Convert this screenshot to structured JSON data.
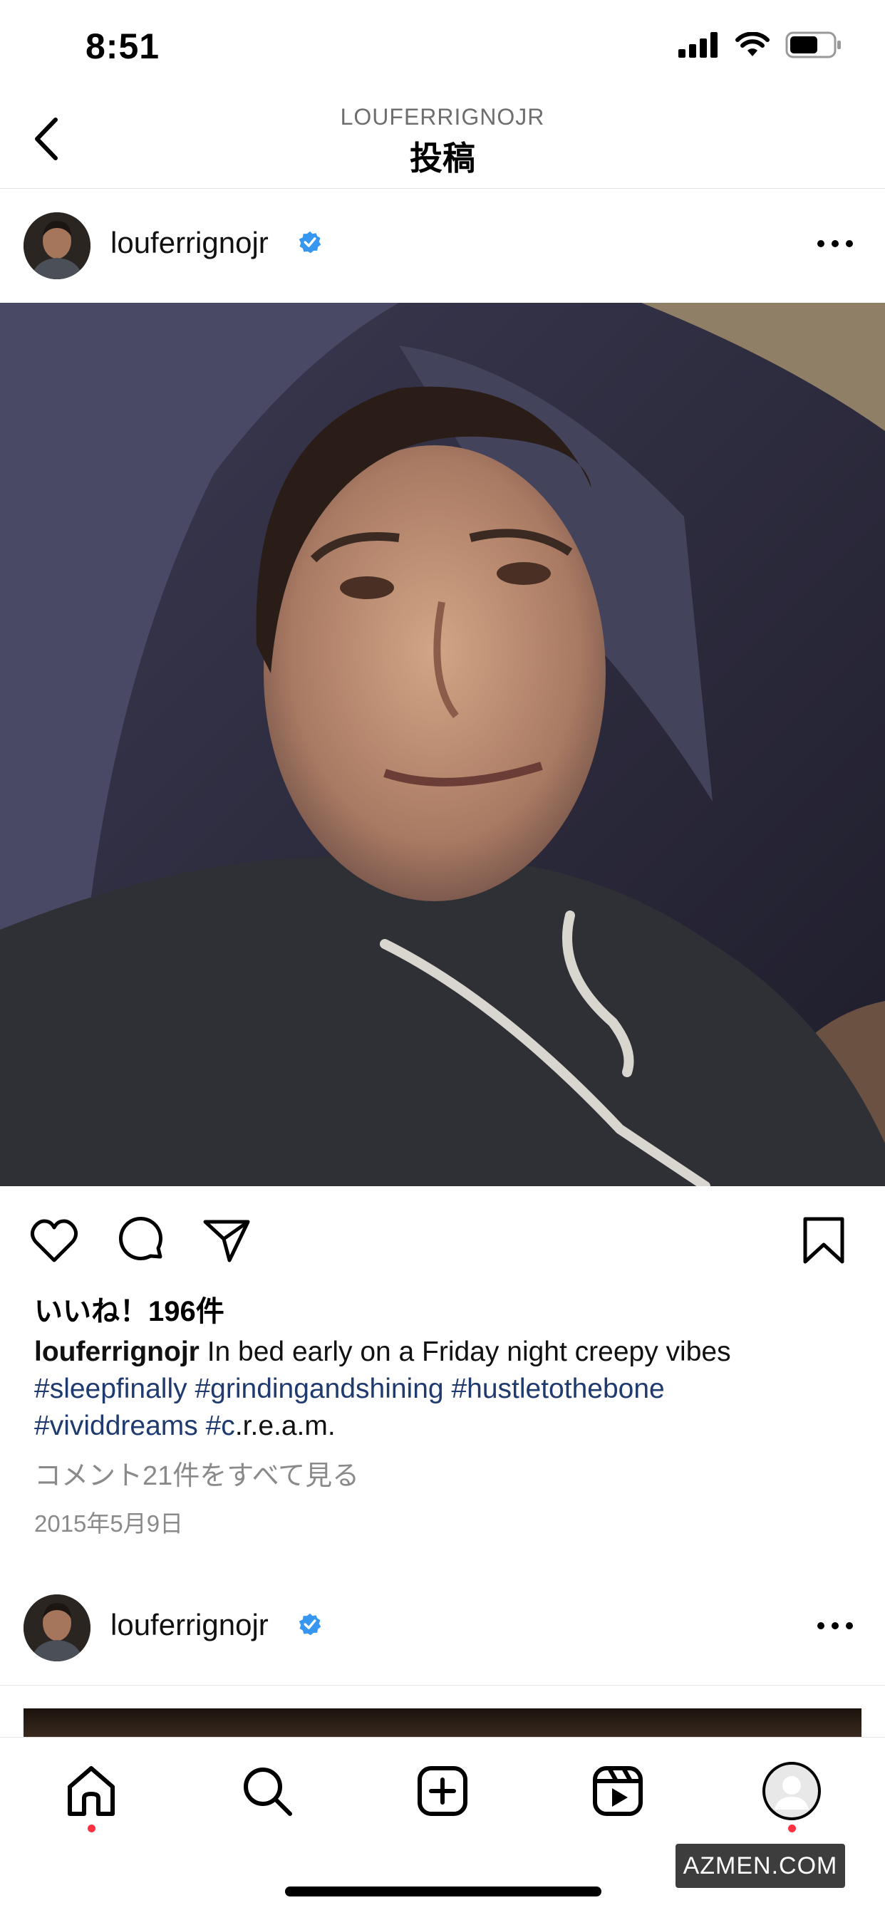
{
  "status_bar": {
    "time": "8:51"
  },
  "header": {
    "account": "LOUFERRIGNOJR",
    "title": "投稿"
  },
  "post": {
    "username": "louferrignojr",
    "likes": "いいね！196件",
    "caption_user": "louferrignojr",
    "caption_text": "In bed early on a Friday night creepy vibes",
    "hashtags": [
      "#sleepfinally",
      "#grindingandshining",
      "#hustletothebone",
      "#vividdreams",
      "#c"
    ],
    "caption_tail": ".r.e.a.m.",
    "view_comments": "コメント21件をすべて見る",
    "date": "2015年5月9日"
  },
  "next_post": {
    "username": "louferrignojr"
  },
  "tab_bar": {
    "items": [
      "home-icon",
      "search-icon",
      "create-icon",
      "reels-icon",
      "profile-avatar"
    ]
  },
  "watermark": "AZMEN.COM",
  "colors": {
    "verified": "#3797f0",
    "hashtag": "#1f3a6e",
    "notification_dot": "#ff3040"
  }
}
